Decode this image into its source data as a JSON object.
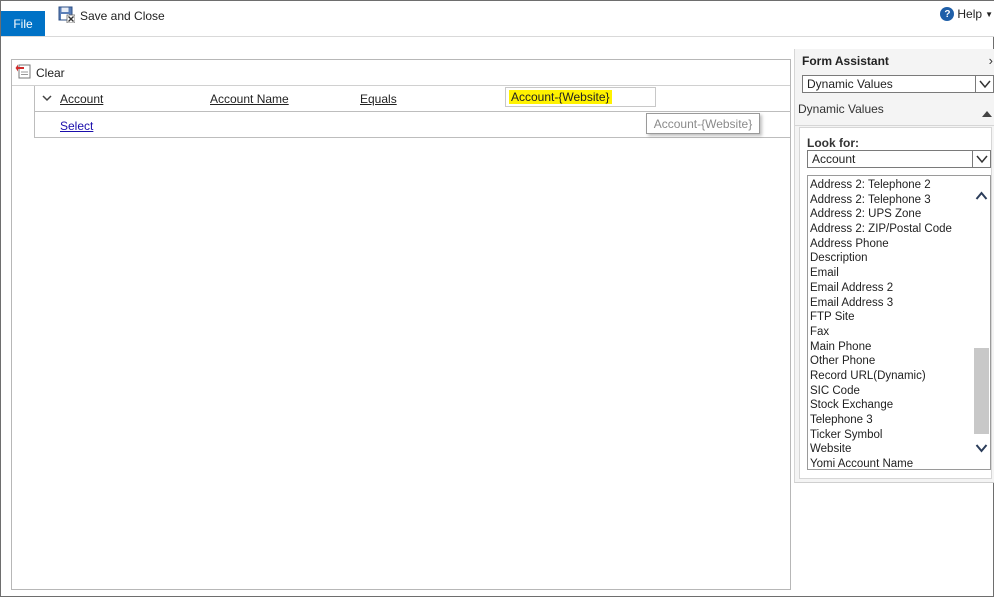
{
  "ribbon": {
    "file_tab": "File",
    "save_close_label": "Save and Close",
    "help_label": "Help"
  },
  "main": {
    "clear_label": "Clear",
    "condition": {
      "entity": "Account",
      "field": "Account Name",
      "operator": "Equals",
      "value": "Account-{Website}"
    },
    "select_label": "Select",
    "tooltip": "Account-{Website}"
  },
  "form_assistant": {
    "title": "Form Assistant",
    "mode_dropdown": "Dynamic Values",
    "section_title": "Dynamic Values",
    "look_for_label": "Look for:",
    "look_for_value": "Account",
    "fields": [
      "Address 2: Telephone 2",
      "Address 2: Telephone 3",
      "Address 2: UPS Zone",
      "Address 2: ZIP/Postal Code",
      "Address Phone",
      "Description",
      "Email",
      "Email Address 2",
      "Email Address 3",
      "FTP Site",
      "Fax",
      "Main Phone",
      "Other Phone",
      "Record URL(Dynamic)",
      "SIC Code",
      "Stock Exchange",
      "Telephone 3",
      "Ticker Symbol",
      "Website",
      "Yomi Account Name"
    ]
  },
  "colors": {
    "accent": "#0072c6",
    "highlight": "#fff200",
    "link": "#1a0dab"
  },
  "icons": [
    "save-close-icon",
    "help-icon",
    "clear-icon",
    "chevron-down-icon",
    "close-icon",
    "collapse-up-icon",
    "scroll-up-icon",
    "scroll-down-icon"
  ]
}
